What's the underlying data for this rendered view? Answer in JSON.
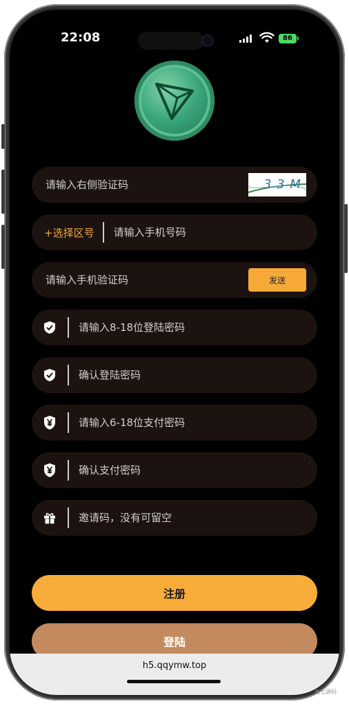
{
  "status_bar": {
    "time": "22:08",
    "battery": "86"
  },
  "form": {
    "captcha_placeholder": "请输入右侧验证码",
    "zone_label": "+选择区号",
    "phone_placeholder": "请输入手机号码",
    "sms_placeholder": "请输入手机验证码",
    "send_label": "发送",
    "login_password_placeholder": "请输入8-18位登陆密码",
    "confirm_login_placeholder": "确认登陆密码",
    "pay_password_placeholder": "请输入6-18位支付密码",
    "confirm_pay_placeholder": "确认支付密码",
    "invite_placeholder": "邀请码，没有可留空",
    "captcha_text": "3 3 M"
  },
  "actions": {
    "register_label": "注册",
    "login_label": "登陆"
  },
  "browser": {
    "url": "h5.qqymw.top"
  },
  "watermark": "七七源码",
  "colors": {
    "accent": "#f8ad3b",
    "field_bg": "#1c1310",
    "login_bg": "#c28a5e"
  }
}
